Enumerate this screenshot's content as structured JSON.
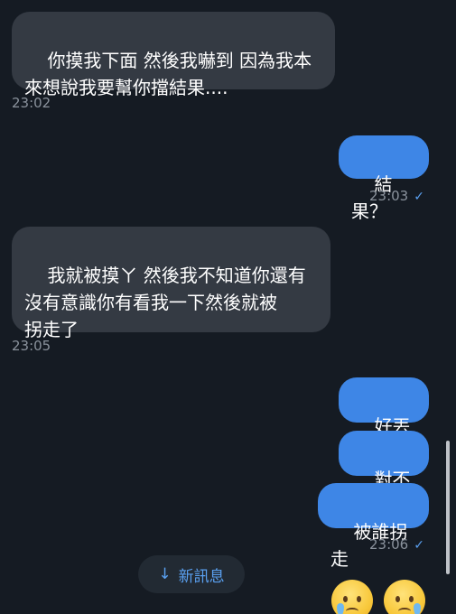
{
  "messages": [
    {
      "id": "m1",
      "text": "你摸我下面 然後我嚇到 因為我本\n來想說我要幫你擋結果....",
      "time": "23:02"
    },
    {
      "id": "m2",
      "text": "結果？",
      "time": "23:03",
      "check": "✓"
    },
    {
      "id": "m3",
      "text": "我就被摸ㄚ 然後我不知道你還有\n沒有意識你有看我一下然後就被\n拐走了",
      "time": "23:05"
    },
    {
      "id": "m4",
      "text": "好丟臉"
    },
    {
      "id": "m5",
      "text": "對不起"
    },
    {
      "id": "m6",
      "text": "被誰拐走",
      "time": "23:06",
      "check": "✓"
    }
  ],
  "new_messages_button": {
    "arrow": "↓",
    "label": "新訊息"
  },
  "reactions": [
    {
      "icon": "crying-face-icon"
    },
    {
      "icon": "crying-face-icon"
    }
  ],
  "colors": {
    "background": "#151b23",
    "incoming_bubble": "#343a43",
    "outgoing_bubble": "#3e86e6",
    "accent": "#5aa0f0",
    "timestamp": "#8a929c"
  }
}
